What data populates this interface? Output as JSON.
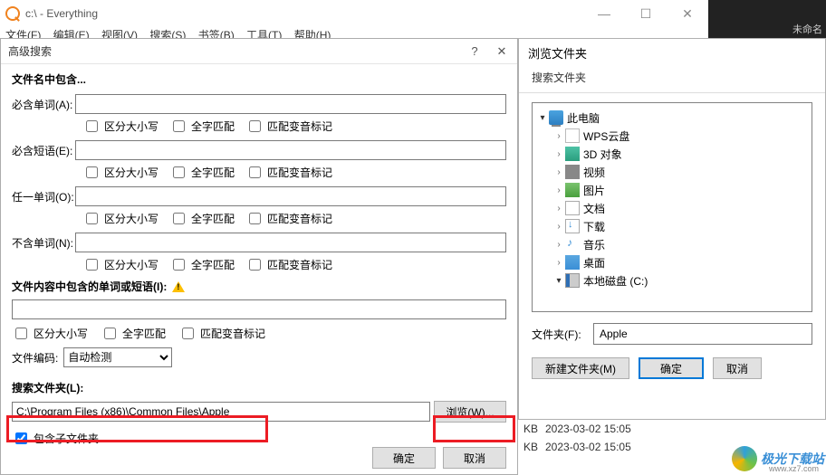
{
  "main_window": {
    "title": "c:\\ - Everything",
    "menu": [
      "文件(F)",
      "编辑(E)",
      "视图(V)",
      "搜索(S)",
      "书签(B)",
      "工具(T)",
      "帮助(H)"
    ],
    "dark_text": "未命名"
  },
  "adv_search": {
    "title": "高级搜索",
    "section_filename": "文件名中包含...",
    "labels": {
      "all_words": "必含单词(A):",
      "phrase": "必含短语(E):",
      "any_word": "任一单词(O):",
      "none_word": "不含单词(N):"
    },
    "checks": {
      "case": "区分大小写",
      "whole": "全字匹配",
      "diacritic": "匹配变音标记"
    },
    "content_hdr": "文件内容中包含的单词或短语(I):",
    "encoding_label": "文件编码:",
    "encoding_value": "自动检测",
    "search_folder_label": "搜索文件夹(L):",
    "path_value": "C:\\Program Files (x86)\\Common Files\\Apple",
    "browse_btn": "浏览(W)...",
    "include_sub": "包含子文件夹",
    "ok": "确定",
    "cancel": "取消"
  },
  "browse_folder": {
    "title": "浏览文件夹",
    "instruction": "搜索文件夹",
    "tree": [
      {
        "ind": 0,
        "arrow": "v",
        "ico": "ico-pc",
        "label": "此电脑"
      },
      {
        "ind": 1,
        "arrow": ">",
        "ico": "ico-cloud",
        "label": "WPS云盘"
      },
      {
        "ind": 1,
        "arrow": ">",
        "ico": "ico-3d",
        "label": "3D 对象"
      },
      {
        "ind": 1,
        "arrow": ">",
        "ico": "ico-video",
        "label": "视频"
      },
      {
        "ind": 1,
        "arrow": ">",
        "ico": "ico-pic",
        "label": "图片"
      },
      {
        "ind": 1,
        "arrow": ">",
        "ico": "ico-doc",
        "label": "文档"
      },
      {
        "ind": 1,
        "arrow": ">",
        "ico": "ico-dl",
        "label": "下载"
      },
      {
        "ind": 1,
        "arrow": ">",
        "ico": "ico-music",
        "label": "音乐"
      },
      {
        "ind": 1,
        "arrow": ">",
        "ico": "ico-desk",
        "label": "桌面"
      },
      {
        "ind": 1,
        "arrow": "v",
        "ico": "ico-disk",
        "label": "本地磁盘 (C:)"
      }
    ],
    "folder_label": "文件夹(F):",
    "folder_value": "Apple",
    "new_folder": "新建文件夹(M)",
    "ok": "确定",
    "cancel": "取消"
  },
  "file_list": [
    {
      "size": "KB",
      "date": "2023-03-02 15:05"
    },
    {
      "size": "KB",
      "date": "2023-03-02 15:05"
    }
  ],
  "watermark": {
    "text": "极光下载站",
    "sub": "www.xz7.com"
  }
}
